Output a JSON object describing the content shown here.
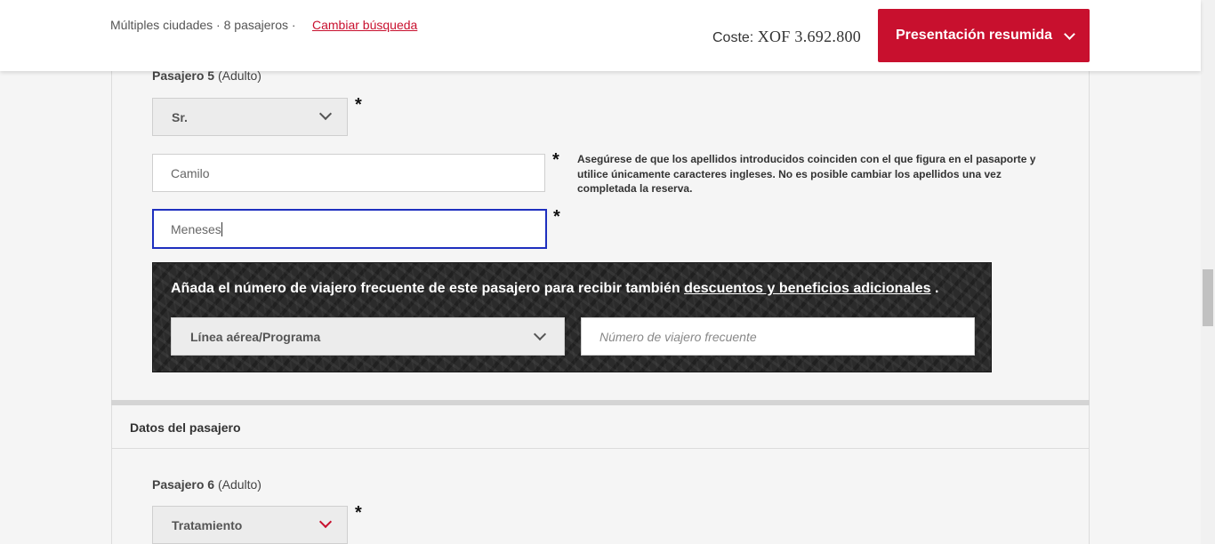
{
  "header": {
    "search_summary": "Múltiples ciudades · 8 pasajeros ·",
    "change_search_link": "Cambiar búsqueda",
    "cost_label": "Coste:",
    "cost_value": "XOF 3.692.800",
    "summary_button": "Presentación resumida",
    "accent_color": "#c8102e"
  },
  "passenger5": {
    "label_bold": "Pasajero 5",
    "label_type": "(Adulto)",
    "title_select_value": "Sr.",
    "first_name_value": "Camilo",
    "last_name_value": "Meneses",
    "required_mark": "*",
    "surname_note": "Asegúrese de que los apellidos introducidos coinciden con el que figura en el pasaporte y utilice únicamente caracteres ingleses. No es posible cambiar los apellidos una vez completada la reserva."
  },
  "frequent_flyer": {
    "text_before": "Añada el número de viajero frecuente de este pasajero para recibir también",
    "link_text": "descuentos y beneficios adicionales",
    "text_after": ".",
    "airline_select": "Línea aérea/Programa",
    "number_placeholder": "Número de viajero frecuente"
  },
  "section": {
    "title": "Datos del pasajero"
  },
  "passenger6": {
    "label_bold": "Pasajero 6",
    "label_type": "(Adulto)",
    "title_select_value": "Tratamiento",
    "required_mark": "*"
  }
}
